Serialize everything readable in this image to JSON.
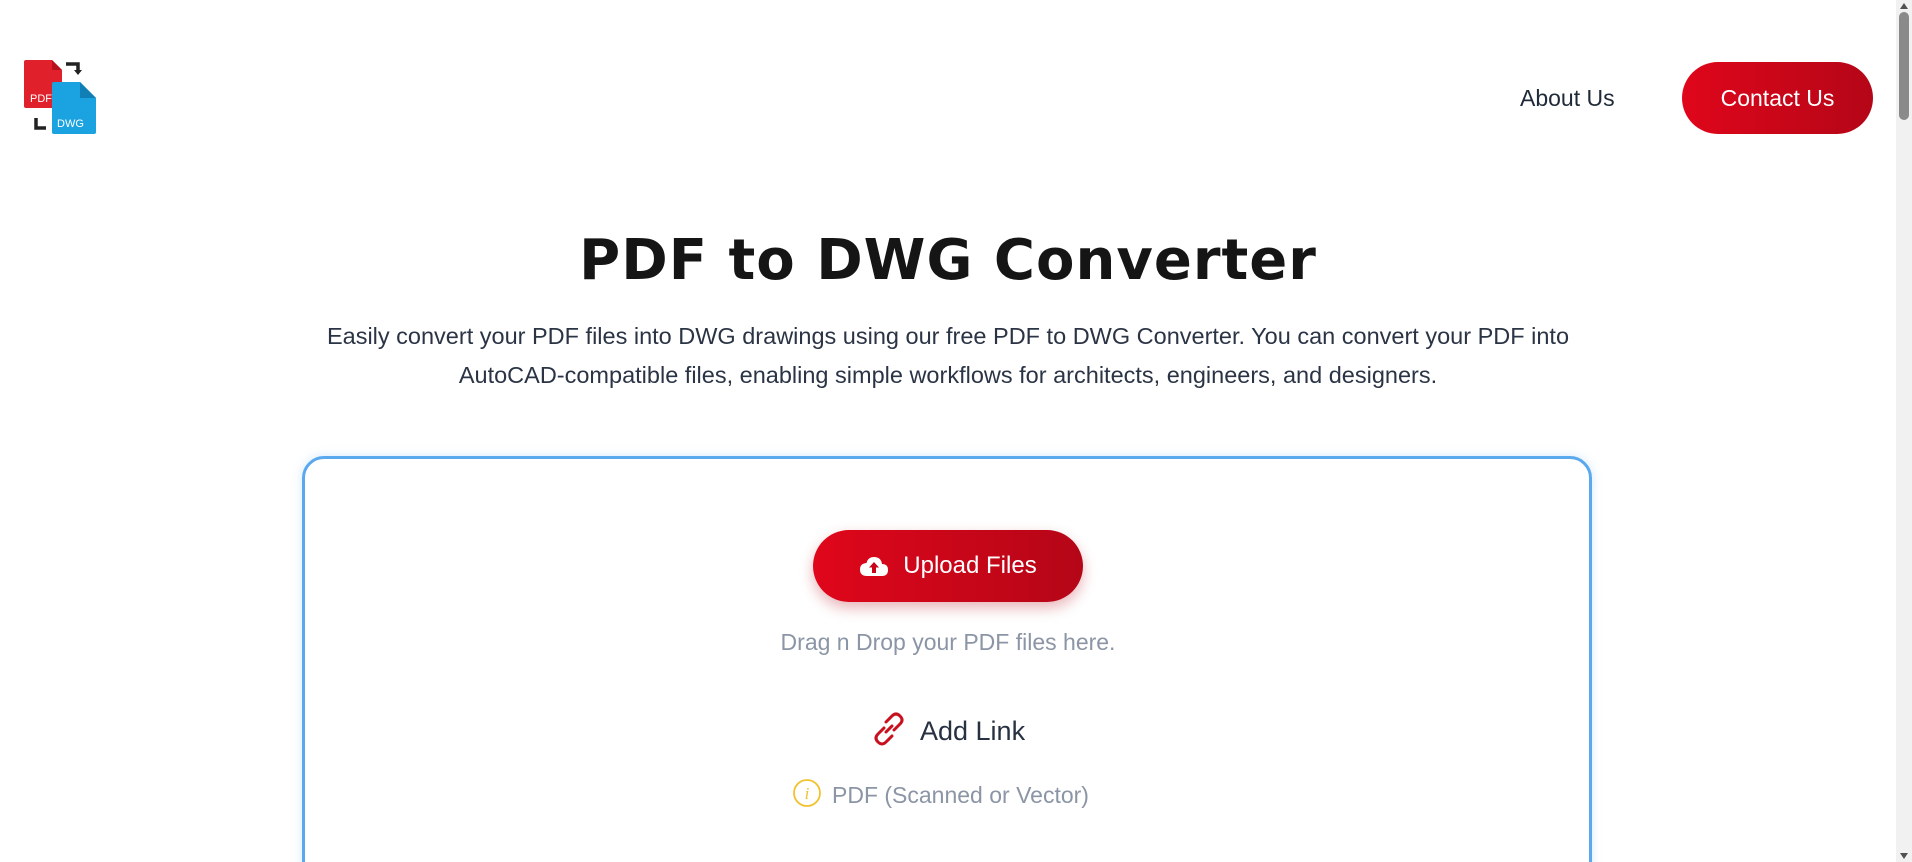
{
  "header": {
    "logo": {
      "icon": "pdf-to-dwg-logo-icon",
      "pdf_text": "PDF",
      "dwg_text": "DWG",
      "colors": {
        "pdf": "#e0202a",
        "dwg": "#1aa3e0",
        "arrows": "#222222"
      }
    },
    "nav": {
      "about_label": "About Us",
      "contact_label": "Contact Us"
    }
  },
  "hero": {
    "title": "PDF to DWG Converter",
    "description": "Easily convert your PDF files into DWG drawings using our free PDF to DWG Converter. You can convert your PDF into AutoCAD-compatible files, enabling simple workflows for architects, engineers, and designers."
  },
  "upload": {
    "button_icon": "cloud-upload-icon",
    "button_label": "Upload Files",
    "drag_text": "Drag n Drop your PDF files here.",
    "add_link_icon": "link-icon",
    "add_link_label": "Add Link",
    "info_icon": "info-icon",
    "format_text": "PDF (Scanned or Vector)"
  },
  "colors": {
    "accent_red": "#e0061b",
    "accent_red_dark": "#b40617",
    "card_border": "#5aa8ee",
    "info_yellow": "#f2c230",
    "muted_text": "#8b95a5"
  }
}
